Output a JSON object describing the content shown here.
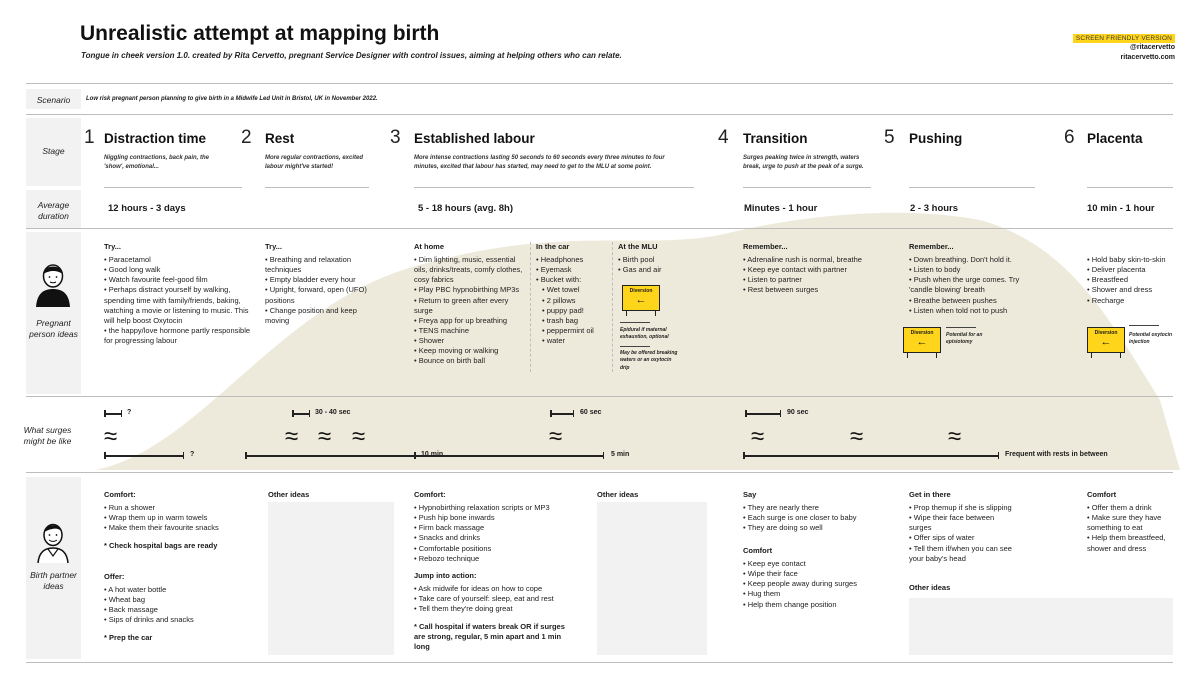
{
  "header": {
    "title": "Unrealistic attempt at mapping birth",
    "subtitle": "Tongue in cheek version 1.0. created by Rita Cervetto, pregnant Service Designer with control issues, aiming at helping others who can relate.",
    "badge": "SCREEN FRIENDLY VERSION",
    "handle": "@ritacervetto",
    "site": "ritacervetto.com"
  },
  "scenario": {
    "label": "Scenario",
    "text": "Low risk pregnant person planning to give birth in a Midwife Led Unit in Bristol, UK in November 2022."
  },
  "row_labels": {
    "stage": "Stage",
    "duration": "Average duration",
    "pregnant": "Pregnant person ideas",
    "surges": "What surges might be like",
    "partner": "Birth partner ideas"
  },
  "stages": [
    {
      "num": "1",
      "name": "Distraction time",
      "desc": "Niggling contractions, back pain, the 'show', emotional..."
    },
    {
      "num": "2",
      "name": "Rest",
      "desc": "More regular contractions, excited labour might've started!"
    },
    {
      "num": "3",
      "name": "Established labour",
      "desc": "More intense contractions lasting 50 seconds to 60 seconds every three minutes to four minutes, excited that labour has started, may need to get to the MLU at some point."
    },
    {
      "num": "4",
      "name": "Transition",
      "desc": "Surges peaking twice in strength, waters break, urge to push at the peak of a surge."
    },
    {
      "num": "5",
      "name": "Pushing",
      "desc": ""
    },
    {
      "num": "6",
      "name": "Placenta",
      "desc": ""
    }
  ],
  "durations": [
    "12 hours - 3 days",
    "5 - 18 hours (avg. 8h)",
    "Minutes - 1 hour",
    "2 - 3 hours",
    "10 min - 1 hour"
  ],
  "pregnant": {
    "s1": {
      "head": "Try...",
      "items": [
        "Paracetamol",
        "Good long walk",
        "Watch favourite feel-good film",
        "Perhaps distract yourself by walking, spending time with family/friends, baking, watching a movie or listening to music. This will help boost Oxytocin",
        "the happy/love hormone partly responsible for progressing labour"
      ]
    },
    "s2": {
      "head": "Try...",
      "items": [
        "Breathing and relaxation techniques",
        "Empty bladder every hour",
        "Upright, forward, open (UFO) positions",
        "Change position and keep moving"
      ]
    },
    "s3_home": {
      "head": "At home",
      "items": [
        "Dim lighting, music, essential oils, drinks/treats, comfy clothes, cosy fabrics",
        "Play PBC hypnobirthing MP3s",
        "Return to green after every surge",
        "Freya app for up breathing",
        "TENS machine",
        "Shower",
        "Keep moving or walking",
        "Bounce on birth ball"
      ]
    },
    "s3_car": {
      "head": "In the car",
      "items": [
        "Headphones",
        "Eyemask",
        "Bucket with:",
        "Wet towel",
        "2 pillows",
        "puppy pad!",
        "trash bag",
        "peppermint oil",
        "water"
      ]
    },
    "s3_mlu": {
      "head": "At the MLU",
      "items": [
        "Birth pool",
        "Gas and air"
      ],
      "sign": "Diversion",
      "note1": "Epidural if maternal exhaustion, optional",
      "note2": "May be offered breaking waters or an oxytocin drip"
    },
    "s4": {
      "head": "Remember...",
      "items": [
        "Adrenaline rush is normal, breathe",
        "Keep eye contact with partner",
        "Listen to partner",
        "Rest between surges"
      ]
    },
    "s5": {
      "head": "Remember...",
      "items": [
        "Down breathing. Don't hold it.",
        "Listen to body",
        "Push when the urge comes. Try 'candle blowing' breath",
        "Breathe between pushes",
        "Listen when told not to push"
      ],
      "sign": "Diversion",
      "note": "Potential for an episiotomy"
    },
    "s6": {
      "items": [
        "Hold baby skin-to-skin",
        "Deliver placenta",
        "Breastfeed",
        "Shower and dress",
        "Recharge"
      ],
      "sign": "Diversion",
      "note": "Potential oxytocin injection"
    }
  },
  "surges": {
    "s1_top": "?",
    "s1_bottom": "?",
    "s2_top": "30 - 40 sec",
    "s2_bottom": "10 min",
    "s3_top": "60 sec",
    "s3_bottom": "5 min",
    "s4_top": "90 sec",
    "s4_bottom": "Frequent with rests in between",
    "wave_glyph": "≈"
  },
  "partner": {
    "s1": {
      "head": "Comfort:",
      "items": [
        "Run a shower",
        "Wrap them up in warm towels",
        "Make them their favourite snacks"
      ],
      "note1": "* Check hospital bags are ready",
      "head2": "Offer:",
      "items2": [
        "A hot water bottle",
        "Wheat bag",
        "Back massage",
        "Sips of drinks and snacks"
      ],
      "note2": "* Prep the car"
    },
    "s2": {
      "head": "Other ideas"
    },
    "s3": {
      "head": "Comfort:",
      "items": [
        "Hypnobirthing relaxation scripts or MP3",
        "Push hip bone inwards",
        "Firm back massage",
        "Snacks and drinks",
        "Comfortable positions",
        "Rebozo technique"
      ],
      "head2": "Jump into action:",
      "items2": [
        "Ask midwife for ideas on how to cope",
        "Take care of yourself: sleep, eat and rest",
        "Tell them they're doing great"
      ],
      "note": "* Call hospital if waters break OR if surges are strong, regular, 5 min apart and 1 min long"
    },
    "s3b": {
      "head": "Other ideas"
    },
    "s4": {
      "head": "Say",
      "items": [
        "They are nearly there",
        "Each surge is one closer to baby",
        "They are doing so well"
      ],
      "head2": "Comfort",
      "items2": [
        "Keep eye contact",
        "Wipe their face",
        "Keep people away during surges",
        "Hug them",
        "Help them change position"
      ]
    },
    "s5": {
      "head": "Get in there",
      "items": [
        "Prop themup if she is slipping",
        "Wipe their face between surges",
        "Offer sips of water",
        "Tell them if/when you can see your baby's head"
      ],
      "head2": "Other ideas"
    },
    "s6": {
      "head": "Comfort",
      "items": [
        "Offer them a drink",
        "Make sure they have something to eat",
        "Help them breastfeed, shower and dress"
      ]
    }
  },
  "colors": {
    "accent": "#ffd51c",
    "curve": "#eeeadb",
    "band": "#f2f2f2"
  }
}
